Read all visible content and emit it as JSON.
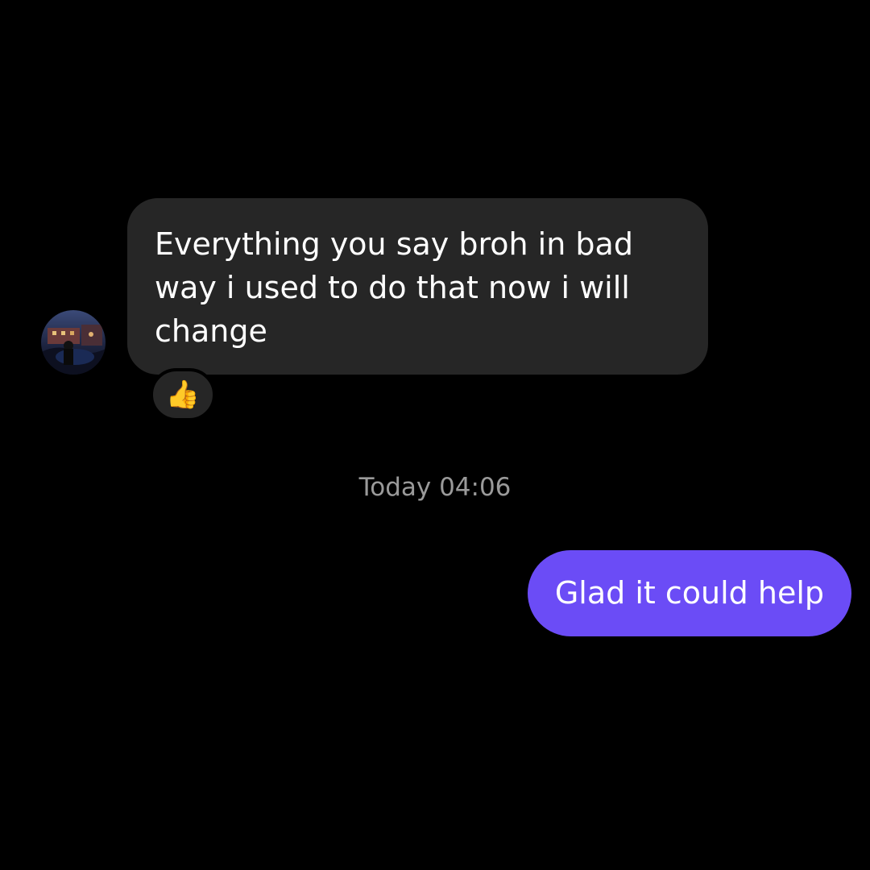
{
  "colors": {
    "background": "#000000",
    "incoming_bubble": "#262626",
    "outgoing_bubble": "#6b4cf6",
    "timestamp_text": "#9a9a9a"
  },
  "incoming_message": {
    "text": "Everything  you say broh in bad\nway i used  to do that now i will\nchange",
    "reaction": "👍",
    "avatar_icon": "user-avatar-photo"
  },
  "timestamp": "Today 04:06",
  "outgoing_message": {
    "text": "Glad it could help"
  }
}
